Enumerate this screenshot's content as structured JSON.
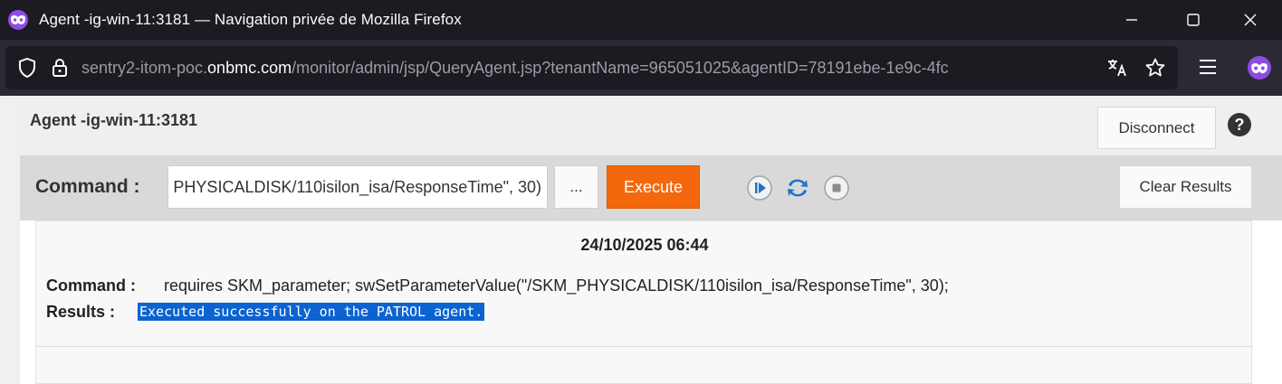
{
  "window": {
    "title": "Agent -ig-win-11:3181 — Navigation privée de Mozilla Firefox"
  },
  "address_bar": {
    "url_prefix": "sentry2-itom-poc.",
    "url_domain": "onbmc.com",
    "url_path": "/monitor/admin/jsp/QueryAgent.jsp?tenantName=965051025&agentID=78191ebe-1e9c-4fc"
  },
  "header": {
    "agent_title": "Agent -ig-win-11:3181",
    "disconnect_label": "Disconnect",
    "help_symbol": "?"
  },
  "command_bar": {
    "label": "Command :",
    "input_value": "requires SKM_parameter; swSetParameterValue(\"/SKM_PHYSICALDISK/110isilon_isa/ResponseTime\", 30);",
    "more_label": "...",
    "execute_label": "Execute",
    "clear_label": "Clear Results"
  },
  "results": {
    "date": "24/10/2025 06:44",
    "command_label": "Command :",
    "command_value": "requires SKM_parameter; swSetParameterValue(\"/SKM_PHYSICALDISK/110isilon_isa/ResponseTime\", 30);",
    "results_label": "Results :",
    "results_value": "Executed successfully on the PATROL agent."
  },
  "colors": {
    "accent": "#f4680d",
    "private_purple": "#8f4be4",
    "selection": "#0a63d1"
  }
}
